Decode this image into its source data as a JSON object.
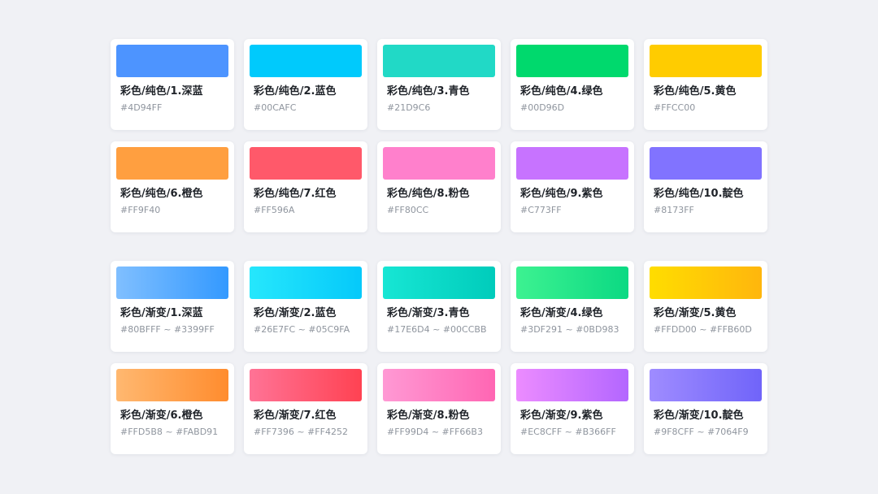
{
  "solid": [
    {
      "name": "彩色/纯色/1.深蓝",
      "code": "#4D94FF",
      "colors": [
        "#4D94FF"
      ]
    },
    {
      "name": "彩色/纯色/2.蓝色",
      "code": "#00CAFC",
      "colors": [
        "#00CAFC"
      ]
    },
    {
      "name": "彩色/纯色/3.青色",
      "code": "#21D9C6",
      "colors": [
        "#21D9C6"
      ]
    },
    {
      "name": "彩色/纯色/4.绿色",
      "code": "#00D96D",
      "colors": [
        "#00D96D"
      ]
    },
    {
      "name": "彩色/纯色/5.黄色",
      "code": "#FFCC00",
      "colors": [
        "#FFCC00"
      ]
    },
    {
      "name": "彩色/纯色/6.橙色",
      "code": "#FF9F40",
      "colors": [
        "#FF9F40"
      ]
    },
    {
      "name": "彩色/纯色/7.红色",
      "code": "#FF596A",
      "colors": [
        "#FF596A"
      ]
    },
    {
      "name": "彩色/纯色/8.粉色",
      "code": "#FF80CC",
      "colors": [
        "#FF80CC"
      ]
    },
    {
      "name": "彩色/纯色/9.紫色",
      "code": "#C773FF",
      "colors": [
        "#C773FF"
      ]
    },
    {
      "name": "彩色/纯色/10.靛色",
      "code": "#8173FF",
      "colors": [
        "#8173FF"
      ]
    }
  ],
  "gradient": [
    {
      "name": "彩色/渐变/1.深蓝",
      "code": "#80BFFF ~ #3399FF",
      "colors": [
        "#80BFFF",
        "#3399FF"
      ]
    },
    {
      "name": "彩色/渐变/2.蓝色",
      "code": "#26E7FC ~ #05C9FA",
      "colors": [
        "#26E7FC",
        "#05C9FA"
      ]
    },
    {
      "name": "彩色/渐变/3.青色",
      "code": "#17E6D4 ~ #00CCBB",
      "colors": [
        "#17E6D4",
        "#00CCBB"
      ]
    },
    {
      "name": "彩色/渐变/4.绿色",
      "code": "#3DF291 ~ #0BD983",
      "colors": [
        "#3DF291",
        "#0BD983"
      ]
    },
    {
      "name": "彩色/渐变/5.黄色",
      "code": "#FFDD00 ~ #FFB60D",
      "colors": [
        "#FFDD00",
        "#FFB60D"
      ]
    },
    {
      "name": "彩色/渐变/6.橙色",
      "code": "#FFD5B8 ~ #FABD91",
      "colors": [
        "#FFB870",
        "#FF8C2E"
      ]
    },
    {
      "name": "彩色/渐变/7.红色",
      "code": "#FF7396 ~ #FF4252",
      "colors": [
        "#FF7396",
        "#FF4252"
      ]
    },
    {
      "name": "彩色/渐变/8.粉色",
      "code": "#FF99D4 ~ #FF66B3",
      "colors": [
        "#FF99D4",
        "#FF66B3"
      ]
    },
    {
      "name": "彩色/渐变/9.紫色",
      "code": "#EC8CFF ~ #B366FF",
      "colors": [
        "#EC8CFF",
        "#B366FF"
      ]
    },
    {
      "name": "彩色/渐变/10.靛色",
      "code": "#9F8CFF ~ #7064F9",
      "colors": [
        "#9F8CFF",
        "#7064F9"
      ]
    }
  ]
}
